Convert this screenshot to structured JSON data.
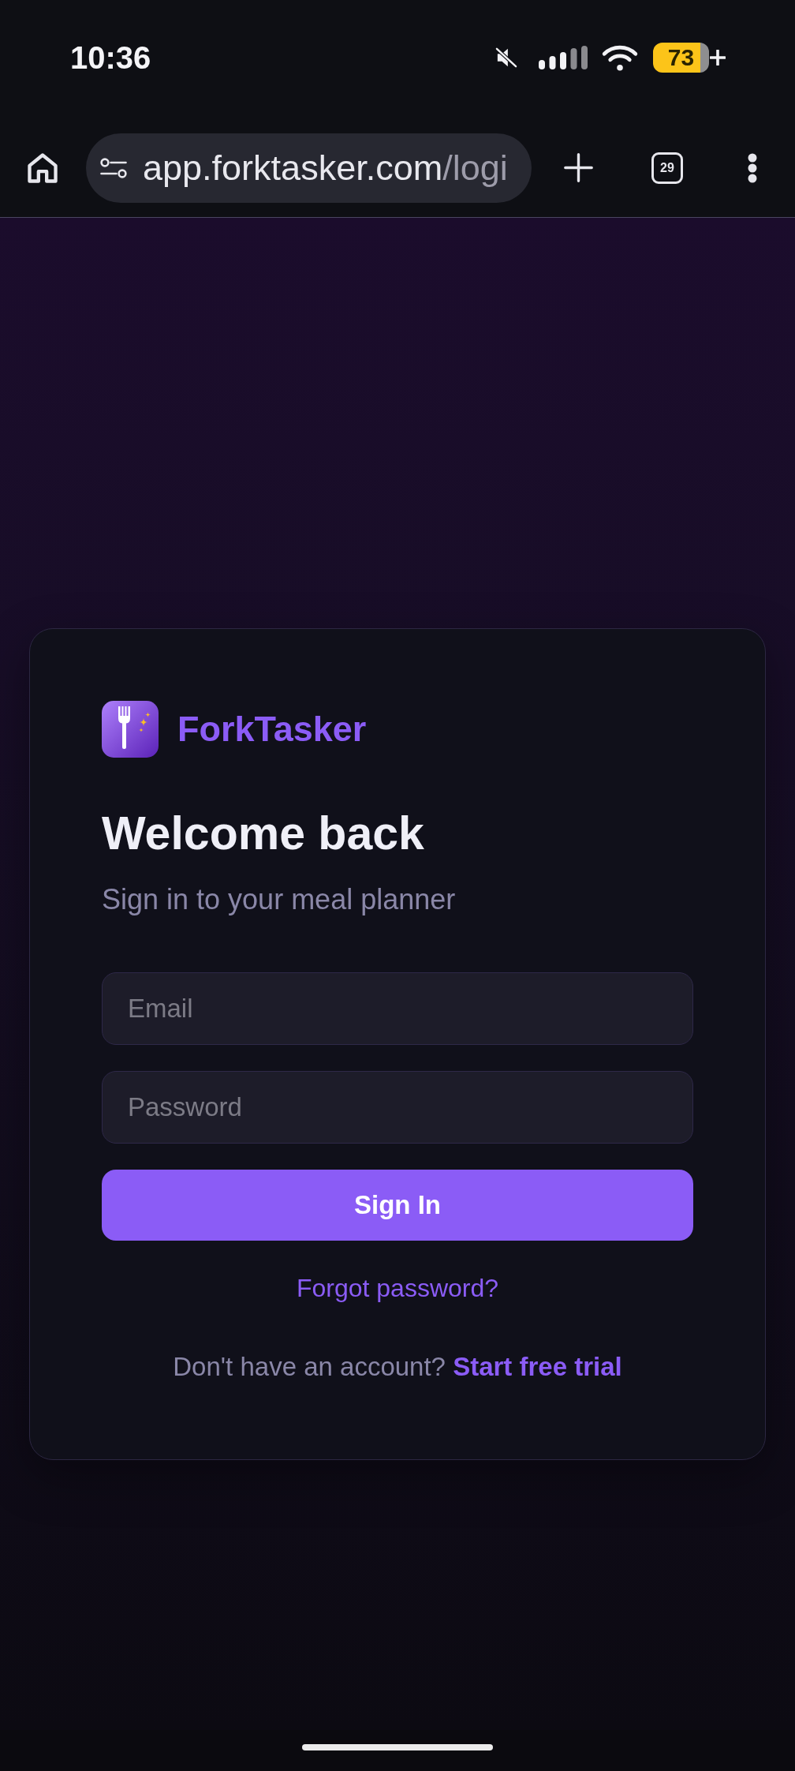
{
  "status_bar": {
    "time": "10:36",
    "battery": "73"
  },
  "browser": {
    "url_host": "app.forktasker.com",
    "url_path": "/logi",
    "tab_count": "29"
  },
  "login": {
    "brand": "ForkTasker",
    "title": "Welcome back",
    "subtitle": "Sign in to your meal planner",
    "fields": [
      {
        "placeholder": "Email"
      },
      {
        "placeholder": "Password"
      }
    ],
    "submit": "Sign In",
    "forgot_link": "Forgot password?",
    "signup_prompt": "Don't have an account?",
    "signup_link": "Start free trial"
  }
}
